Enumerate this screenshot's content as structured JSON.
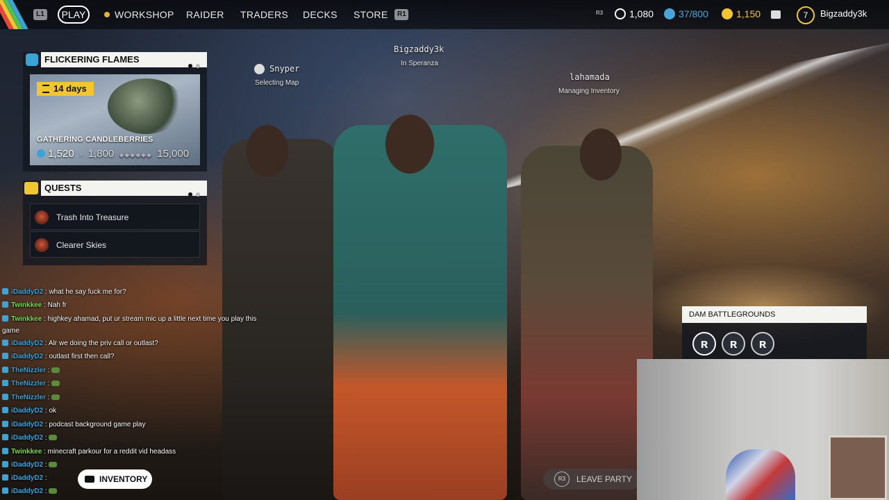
{
  "topbar": {
    "l1": "L1",
    "play": "PLAY",
    "workshop": "WORKSHOP",
    "raider": "RAIDER",
    "traders": "TRADERS",
    "decks": "DECKS",
    "store": "STORE",
    "r1": "R1",
    "r3": "R3",
    "currency_a": "1,080",
    "slots": "37/800",
    "currency_b": "1,150",
    "level": "7",
    "username": "Bigzaddy3k",
    "colors": {
      "accent_yellow": "#f2c531",
      "slots_blue": "#4aa3d8"
    }
  },
  "event_panel": {
    "title": "FLICKERING FLAMES",
    "days": "14 days",
    "event_name": "GATHERING CANDLEBERRIES",
    "progress_current": "1,520",
    "progress_next": "1,800",
    "progress_max": "15,000"
  },
  "quests_panel": {
    "title": "QUESTS",
    "items": [
      {
        "label": "Trash Into Treasure"
      },
      {
        "label": "Clearer Skies"
      }
    ]
  },
  "party": {
    "leader": {
      "name": "Bigzaddy3k",
      "status": "In Speranza"
    },
    "member_left": {
      "name": "Snyper",
      "status": "Selecting Map"
    },
    "member_right": {
      "name": "lahamada",
      "status": "Managing Inventory"
    }
  },
  "chat": {
    "lines": [
      {
        "user": "iDaddyD2",
        "text": ": what he say fuck me for?",
        "color": "#3aa3d8"
      },
      {
        "user": "Twinkkee",
        "text": ": Nah fr",
        "color": "#7ed957"
      },
      {
        "user": "Twinkkee",
        "text": ": highkey ahamad, put ur stream mic up a little next time you play this",
        "color": "#7ed957"
      },
      {
        "user": "",
        "text": "game",
        "color": "#ffffff"
      },
      {
        "user": "iDaddyD2",
        "text": ": Alr we doing the priv call or outlast?",
        "color": "#3aa3d8"
      },
      {
        "user": "iDaddyD2",
        "text": ": outlast first then call?",
        "color": "#3aa3d8"
      },
      {
        "user": "TheNizzler",
        "text": ":",
        "color": "#3aa3d8"
      },
      {
        "user": "TheNizzler",
        "text": ":",
        "color": "#3aa3d8"
      },
      {
        "user": "TheNizzler",
        "text": ":",
        "color": "#3aa3d8"
      },
      {
        "user": "iDaddyD2",
        "text": ": ok",
        "color": "#3aa3d8"
      },
      {
        "user": "iDaddyD2",
        "text": ": podcast background game play",
        "color": "#3aa3d8"
      },
      {
        "user": "iDaddyD2",
        "text": ":",
        "color": "#3aa3d8"
      },
      {
        "user": "Twinkkee",
        "text": ": minecraft parkour for a reddit vid headass",
        "color": "#7ed957"
      },
      {
        "user": "iDaddyD2",
        "text": ":",
        "color": "#3aa3d8"
      },
      {
        "user": "iDaddyD2",
        "text": ":",
        "color": "#3aa3d8"
      },
      {
        "user": "iDaddyD2",
        "text": ":",
        "color": "#3aa3d8"
      }
    ]
  },
  "bottom": {
    "inventory": "INVENTORY",
    "leave_party": "LEAVE PARTY",
    "r3": "R3"
  },
  "map_panel": {
    "title": "DAM BATTLEGROUNDS"
  }
}
